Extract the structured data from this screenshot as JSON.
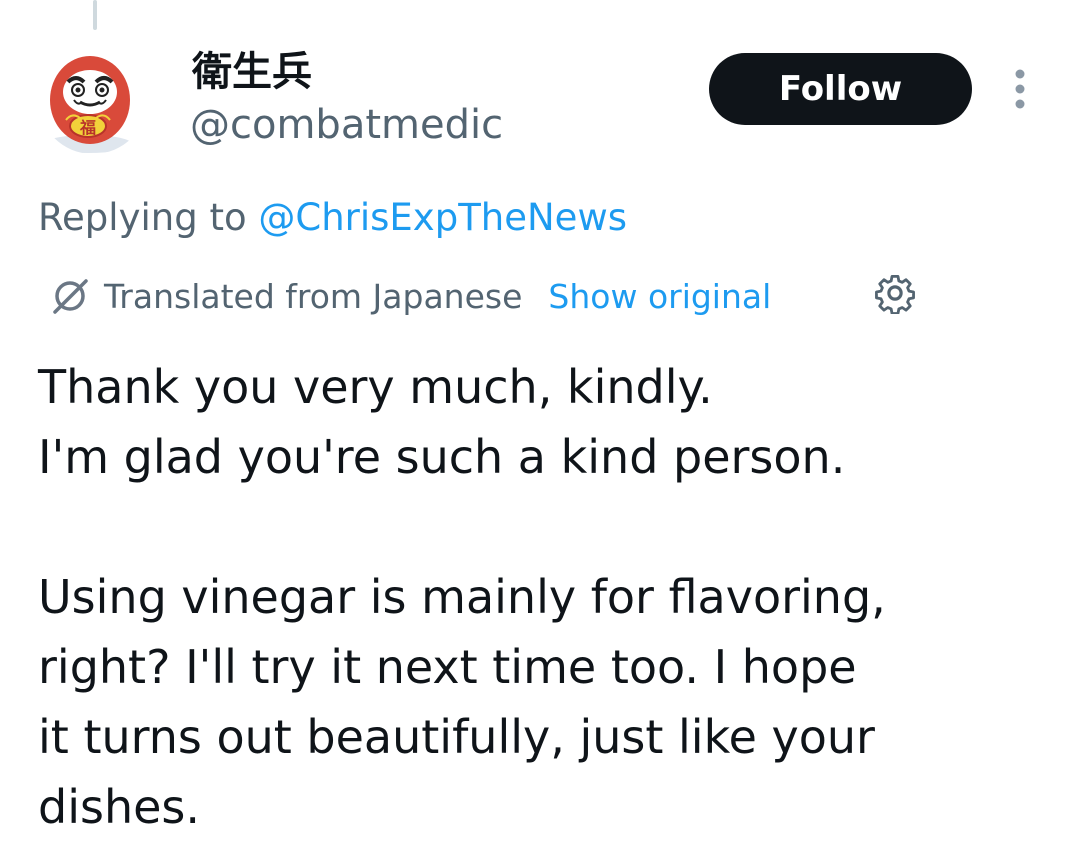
{
  "author": {
    "display_name": "衛生兵",
    "handle": "@combatmedic",
    "avatar_icon": "daruma-avatar"
  },
  "follow_button_label": "Follow",
  "more_icon": "more-vertical-icon",
  "reply": {
    "prefix": "Replying to",
    "mention": "@ChrisExpTheNews"
  },
  "translation": {
    "icon": "translate-icon",
    "label": "Translated from Japanese",
    "show_original": "Show original",
    "settings_icon": "gear-icon"
  },
  "tweet_text": {
    "line1": "Thank you very much, kindly.",
    "line2": "I'm glad you're such a kind person.",
    "line3": "Using vinegar is mainly for flavoring,",
    "line4": "right? I'll try it next time too. I hope",
    "line5": "it turns out beautifully, just like your",
    "line6": "dishes."
  },
  "colors": {
    "text_primary": "#0f1419",
    "text_secondary": "#536471",
    "link": "#1d9bf0",
    "follow_bg": "#0f1419",
    "follow_text": "#ffffff",
    "avatar_red": "#d94a3a"
  }
}
